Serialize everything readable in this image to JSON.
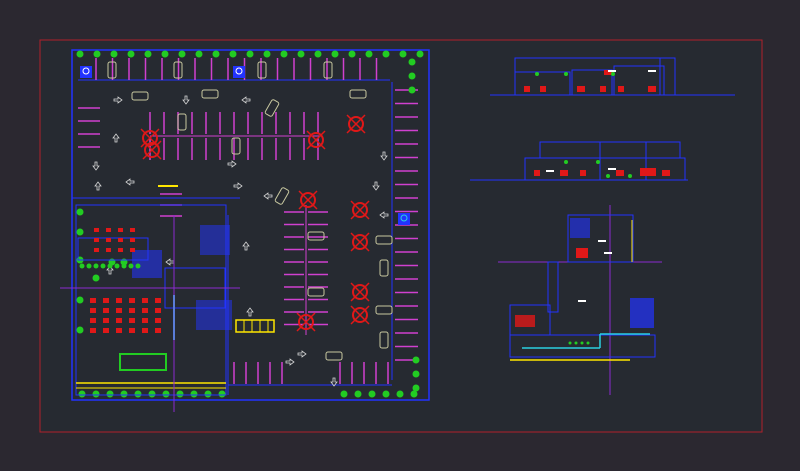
{
  "drawing": {
    "background": "#2b2830",
    "paper_background": "#262a31",
    "colors": {
      "frame": "#b0202a",
      "wall": "#2233ff",
      "parking_line": "#d040d0",
      "tree": "#22cc22",
      "fixture": "#e01818",
      "highlight": "#ffe600",
      "arrow": "#d8d8d8",
      "axis": "#8a2ad0",
      "cyan": "#2ad0e0",
      "white": "#ffffff"
    },
    "sheets": [
      {
        "id": "floor-plan",
        "icon": "parking-lot-floor-plan"
      },
      {
        "id": "elevation-1",
        "icon": "building-elevation"
      },
      {
        "id": "elevation-2",
        "icon": "building-elevation"
      },
      {
        "id": "site-plan",
        "icon": "site-plan"
      }
    ],
    "symbols": [
      "wheelchair-accessible-icon",
      "tree-icon",
      "car-icon",
      "direction-arrow-icon"
    ]
  }
}
